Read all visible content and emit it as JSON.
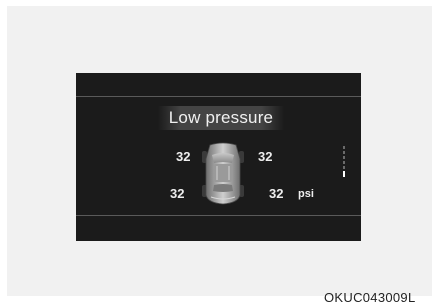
{
  "display": {
    "title": "Low pressure",
    "tires": {
      "front_left": "32",
      "front_right": "32",
      "rear_left": "32",
      "rear_right": "32"
    },
    "unit": "psi",
    "gauge_icon": "vertical-level-gauge-icon",
    "car_icon": "car-top-view-icon"
  },
  "footer": {
    "image_code": "OKUC043009L"
  },
  "colors": {
    "screen_background": "#1b1b1b",
    "text": "#eeeeee",
    "page_background": "#f1f1f1"
  }
}
